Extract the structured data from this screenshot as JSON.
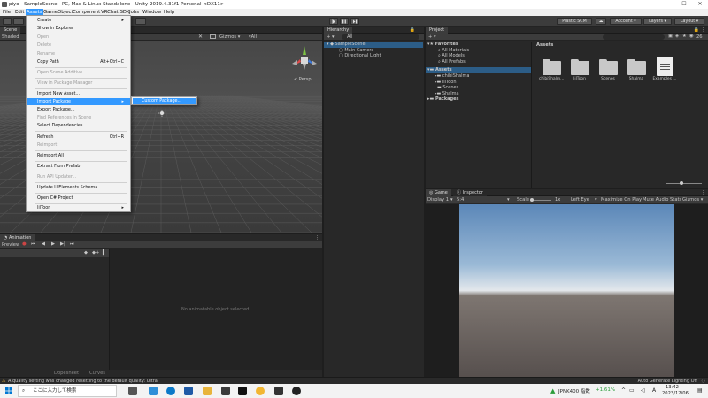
{
  "window": {
    "title": "piyo - SampleScene - PC, Mac & Linux Standalone - Unity 2019.4.31f1 Personal <DX11>",
    "minimize": "—",
    "maximize": "☐",
    "close": "✕"
  },
  "menubar": [
    "File",
    "Edit",
    "Assets",
    "GameObject",
    "Component",
    "VRChat SDK",
    "Jobs",
    "Window",
    "Help"
  ],
  "toolbar": {
    "plastic": "Plastic SCM",
    "account": "Account ▾",
    "layers": "Layers ▾",
    "layout": "Layout ▾"
  },
  "assets_menu": {
    "items": [
      {
        "label": "Create",
        "shortcut": "▸",
        "disabled": false
      },
      {
        "label": "Show in Explorer",
        "shortcut": "",
        "disabled": false
      },
      {
        "label": "Open",
        "shortcut": "",
        "disabled": true
      },
      {
        "label": "Delete",
        "shortcut": "",
        "disabled": true
      },
      {
        "label": "Rename",
        "shortcut": "",
        "disabled": true
      },
      {
        "label": "Copy Path",
        "shortcut": "Alt+Ctrl+C",
        "disabled": false
      },
      {
        "label": "Open Scene Additive",
        "shortcut": "",
        "disabled": true
      },
      {
        "label": "View in Package Manager",
        "shortcut": "",
        "disabled": true
      },
      {
        "label": "Import New Asset...",
        "shortcut": "",
        "disabled": false
      },
      {
        "label": "Import Package",
        "shortcut": "▸",
        "disabled": false
      },
      {
        "label": "Export Package...",
        "shortcut": "",
        "disabled": false
      },
      {
        "label": "Find References In Scene",
        "shortcut": "",
        "disabled": true
      },
      {
        "label": "Select Dependencies",
        "shortcut": "",
        "disabled": false
      },
      {
        "label": "Refresh",
        "shortcut": "Ctrl+R",
        "disabled": false
      },
      {
        "label": "Reimport",
        "shortcut": "",
        "disabled": true
      },
      {
        "label": "Reimport All",
        "shortcut": "",
        "disabled": false
      },
      {
        "label": "Extract From Prefab",
        "shortcut": "",
        "disabled": false
      },
      {
        "label": "Run API Updater...",
        "shortcut": "",
        "disabled": true
      },
      {
        "label": "Update UIElements Schema",
        "shortcut": "",
        "disabled": false
      },
      {
        "label": "Open C# Project",
        "shortcut": "",
        "disabled": false
      },
      {
        "label": "lilToon",
        "shortcut": "▸",
        "disabled": false
      }
    ],
    "submenu_item": "Custom Package..."
  },
  "scene": {
    "tab": "Scene",
    "shaded": "Shaded",
    "gizmos": "Gizmos ▾",
    "all": "▾All",
    "persp": "< Persp"
  },
  "hierarchy": {
    "tab": "Hierarchy",
    "add": "+ ▾",
    "search": "All",
    "scene": "SampleScene",
    "items": [
      "Main Camera",
      "Directional Light"
    ]
  },
  "project": {
    "tab": "Project",
    "add": "+ ▾",
    "favorites": {
      "title": "Favorites",
      "items": [
        "All Materials",
        "All Models",
        "All Prefabs"
      ]
    },
    "assets_title": "Assets",
    "asset_tree": [
      "chibiShalma",
      "lilToon",
      "Scenes",
      "Shalma"
    ],
    "packages": "Packages",
    "breadcrumb": "Assets",
    "grid": [
      {
        "name": "chibiShalm...",
        "kind": "folder"
      },
      {
        "name": "lilToon",
        "kind": "folder"
      },
      {
        "name": "Scenes",
        "kind": "folder"
      },
      {
        "name": "Shalma",
        "kind": "folder"
      },
      {
        "name": "Examples ...",
        "kind": "file"
      }
    ],
    "count": "26"
  },
  "game": {
    "tab_game": "Game",
    "tab_inspector": "Inspector",
    "display": "Display 1",
    "aspect": "5:4",
    "scale_label": "Scale",
    "scale_value": "1x",
    "eye": "Left Eye",
    "max": "Maximize On Play",
    "mute": "Mute Audio",
    "stats": "Stats",
    "gizmos": "Gizmos ▾"
  },
  "animation": {
    "tab": "Animation",
    "preview": "Preview",
    "empty": "No animatable object selected.",
    "dopesheet": "Dopesheet",
    "curves": "Curves"
  },
  "status": {
    "message": "A quality setting was changed resetting to the default quality: Ultra.",
    "right": "Auto Generate Lighting Off"
  },
  "taskbar": {
    "search": "ここに入力して検索",
    "stock": "JPNK400 指数",
    "change": "+1.61%",
    "time": "13:42",
    "date": "2023/12/06"
  }
}
